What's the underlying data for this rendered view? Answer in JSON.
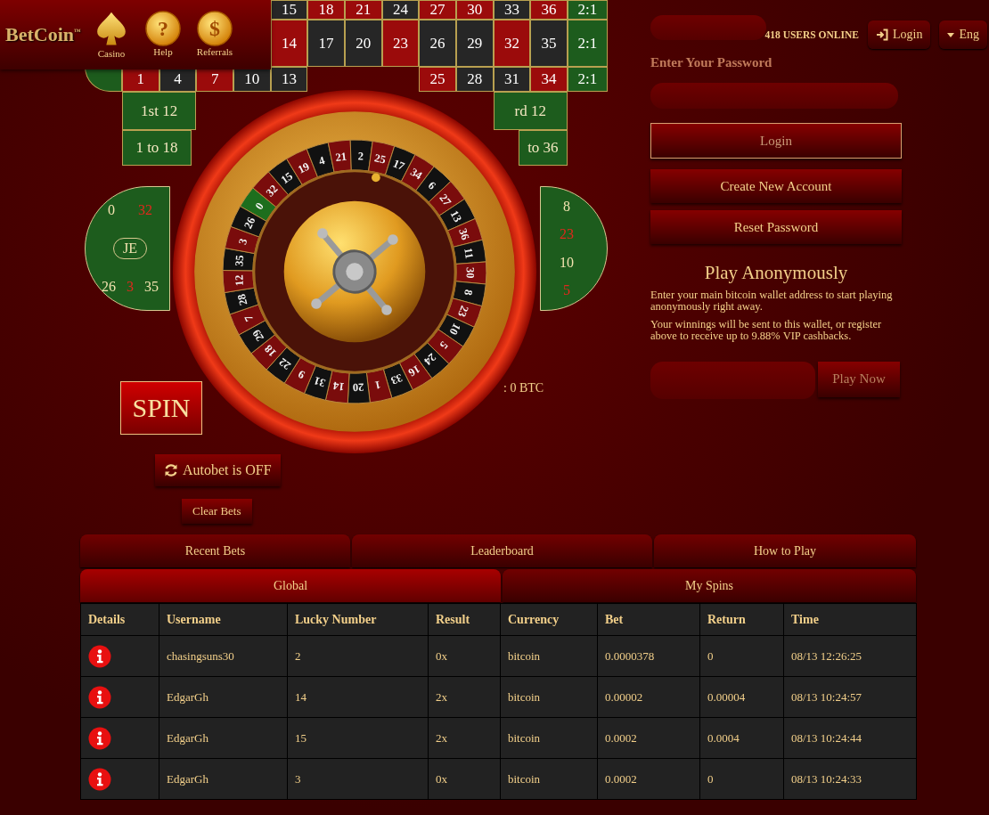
{
  "header": {
    "logo": "BetCoin$^{™}$",
    "nav": [
      {
        "label": "Casino",
        "kind": "spade"
      },
      {
        "label": "Help",
        "kind": "coin",
        "glyph": "?"
      },
      {
        "label": "Referrals",
        "kind": "coin",
        "glyph": "$"
      }
    ],
    "users_online": "418 USERS ONLINE",
    "login": "Login",
    "language": "Eng"
  },
  "board": {
    "rows": [
      {
        "kind": "numbers",
        "left": [],
        "right": [
          {
            "label": "15",
            "color": "#262626"
          },
          {
            "label": "18",
            "color": "#9b0b0b"
          },
          {
            "label": "21",
            "color": "#9b0b0b"
          },
          {
            "label": "24",
            "color": "#262626"
          },
          {
            "label": "27",
            "color": "#9b0b0b"
          },
          {
            "label": "30",
            "color": "#9b0b0b"
          },
          {
            "label": "33",
            "color": "#262626"
          },
          {
            "label": "36",
            "color": "#9b0b0b"
          },
          {
            "label": "2:1",
            "color": "#1d5c1d"
          }
        ]
      },
      {
        "kind": "numbers",
        "left": [],
        "right": [
          {
            "label": "14",
            "color": "#9b0b0b"
          },
          {
            "label": "17",
            "color": "#262626"
          },
          {
            "label": "20",
            "color": "#262626"
          },
          {
            "label": "23",
            "color": "#9b0b0b"
          },
          {
            "label": "26",
            "color": "#262626"
          },
          {
            "label": "29",
            "color": "#262626"
          },
          {
            "label": "32",
            "color": "#9b0b0b"
          },
          {
            "label": "35",
            "color": "#262626"
          },
          {
            "label": "2:1",
            "color": "#1d5c1d"
          }
        ]
      },
      {
        "kind": "numbers",
        "left": [
          {
            "label": "1",
            "color": "#9b0b0b"
          },
          {
            "label": "4",
            "color": "#262626"
          },
          {
            "label": "7",
            "color": "#9b0b0b"
          },
          {
            "label": "10",
            "color": "#262626"
          },
          {
            "label": "13",
            "color": "#262626"
          }
        ],
        "right": [
          {
            "label": "25",
            "color": "#9b0b0b"
          },
          {
            "label": "28",
            "color": "#262626"
          },
          {
            "label": "31",
            "color": "#262626"
          },
          {
            "label": "34",
            "color": "#9b0b0b"
          },
          {
            "label": "2:1",
            "color": "#1d5c1d"
          }
        ]
      },
      {
        "kind": "dozens",
        "left": [
          {
            "label": "1st 12"
          }
        ],
        "right": [
          {
            "label": "rd 12"
          }
        ]
      },
      {
        "kind": "halves",
        "left": [
          {
            "label": "1 to 18"
          }
        ],
        "right": [
          {
            "label": "to 36"
          }
        ]
      }
    ]
  },
  "racetrack": {
    "left": [
      [
        {
          "label": "0",
          "kind": "number",
          "color": "#f3e3b0"
        },
        {
          "label": "32",
          "kind": "number",
          "color": "#e0281c"
        }
      ],
      [
        {
          "label": "JE",
          "kind": "pill",
          "color": "#f3e3b0"
        }
      ],
      [
        {
          "label": "26",
          "kind": "number",
          "color": "#f3e3b0"
        },
        {
          "label": "3",
          "kind": "number",
          "color": "#e0281c"
        },
        {
          "label": "35",
          "kind": "number",
          "color": "#f3e3b0"
        }
      ]
    ],
    "right": [
      [
        {
          "label": "8",
          "kind": "number",
          "color": "#f3e3b0"
        }
      ],
      [
        {
          "label": "23",
          "kind": "number",
          "color": "#e0281c"
        }
      ],
      [
        {
          "label": "10",
          "kind": "number",
          "color": "#f3e3b0"
        }
      ],
      [
        {
          "label": "5",
          "kind": "number",
          "color": "#e0281c"
        }
      ]
    ]
  },
  "wheel": {
    "pockets": [
      {
        "label": "0",
        "color": "#1d6e1d"
      },
      {
        "label": "32",
        "color": "#7a0c0c"
      },
      {
        "label": "15",
        "color": "#111111"
      },
      {
        "label": "19",
        "color": "#7a0c0c"
      },
      {
        "label": "4",
        "color": "#111111"
      },
      {
        "label": "21",
        "color": "#7a0c0c"
      },
      {
        "label": "2",
        "color": "#111111"
      },
      {
        "label": "25",
        "color": "#7a0c0c"
      },
      {
        "label": "17",
        "color": "#111111"
      },
      {
        "label": "34",
        "color": "#7a0c0c"
      },
      {
        "label": "6",
        "color": "#111111"
      },
      {
        "label": "27",
        "color": "#7a0c0c"
      },
      {
        "label": "13",
        "color": "#111111"
      },
      {
        "label": "36",
        "color": "#7a0c0c"
      },
      {
        "label": "11",
        "color": "#111111"
      },
      {
        "label": "30",
        "color": "#7a0c0c"
      },
      {
        "label": "8",
        "color": "#111111"
      },
      {
        "label": "23",
        "color": "#7a0c0c"
      },
      {
        "label": "10",
        "color": "#111111"
      },
      {
        "label": "5",
        "color": "#7a0c0c"
      },
      {
        "label": "24",
        "color": "#111111"
      },
      {
        "label": "16",
        "color": "#7a0c0c"
      },
      {
        "label": "33",
        "color": "#111111"
      },
      {
        "label": "1",
        "color": "#7a0c0c"
      },
      {
        "label": "20",
        "color": "#111111"
      },
      {
        "label": "14",
        "color": "#7a0c0c"
      },
      {
        "label": "31",
        "color": "#111111"
      },
      {
        "label": "9",
        "color": "#7a0c0c"
      },
      {
        "label": "22",
        "color": "#111111"
      },
      {
        "label": "18",
        "color": "#7a0c0c"
      },
      {
        "label": "29",
        "color": "#111111"
      },
      {
        "label": "7",
        "color": "#7a0c0c"
      },
      {
        "label": "28",
        "color": "#111111"
      },
      {
        "label": "12",
        "color": "#7a0c0c"
      },
      {
        "label": "35",
        "color": "#111111"
      },
      {
        "label": "3",
        "color": "#7a0c0c"
      },
      {
        "label": "26",
        "color": "#111111"
      }
    ]
  },
  "controls": {
    "spin": "SPIN",
    "profit": ": 0 BTC",
    "autobet": "Autobet is OFF",
    "clear_bets": "Clear Bets"
  },
  "account": {
    "password_label": "Enter Your Password",
    "login_button": "Login",
    "create_account": "Create New Account",
    "reset_password": "Reset Password",
    "heading": "Play Anonymously",
    "paragraphs": [
      "Enter your main bitcoin wallet address to start playing anonymously right away.",
      "Your winnings will be sent to this wallet, or register above to receive up to 9.88% VIP cashbacks."
    ],
    "play_now": {
      "label": "Play Now",
      "disabled": true
    }
  },
  "tabs": [
    {
      "label": "Recent Bets",
      "selected": false
    },
    {
      "label": "Leaderboard",
      "selected": false
    },
    {
      "label": "How to Play",
      "selected": false
    }
  ],
  "subtabs": [
    {
      "label": "Global",
      "selected": true
    },
    {
      "label": "My Spins",
      "selected": false
    }
  ],
  "table": {
    "columns": [
      "Details",
      "Username",
      "Lucky Number",
      "Result",
      "Currency",
      "Bet",
      "Return",
      "Time"
    ],
    "rows": [
      [
        "",
        "chasingsuns30",
        "2",
        "0x",
        "bitcoin",
        "0.0000378",
        "0",
        "08/13 12:26:25"
      ],
      [
        "",
        "EdgarGh",
        "14",
        "2x",
        "bitcoin",
        "0.00002",
        "0.00004",
        "08/13 10:24:57"
      ],
      [
        "",
        "EdgarGh",
        "15",
        "2x",
        "bitcoin",
        "0.0002",
        "0.0004",
        "08/13 10:24:44"
      ],
      [
        "",
        "EdgarGh",
        "3",
        "0x",
        "bitcoin",
        "0.0002",
        "0",
        "08/13 10:24:33"
      ]
    ]
  }
}
